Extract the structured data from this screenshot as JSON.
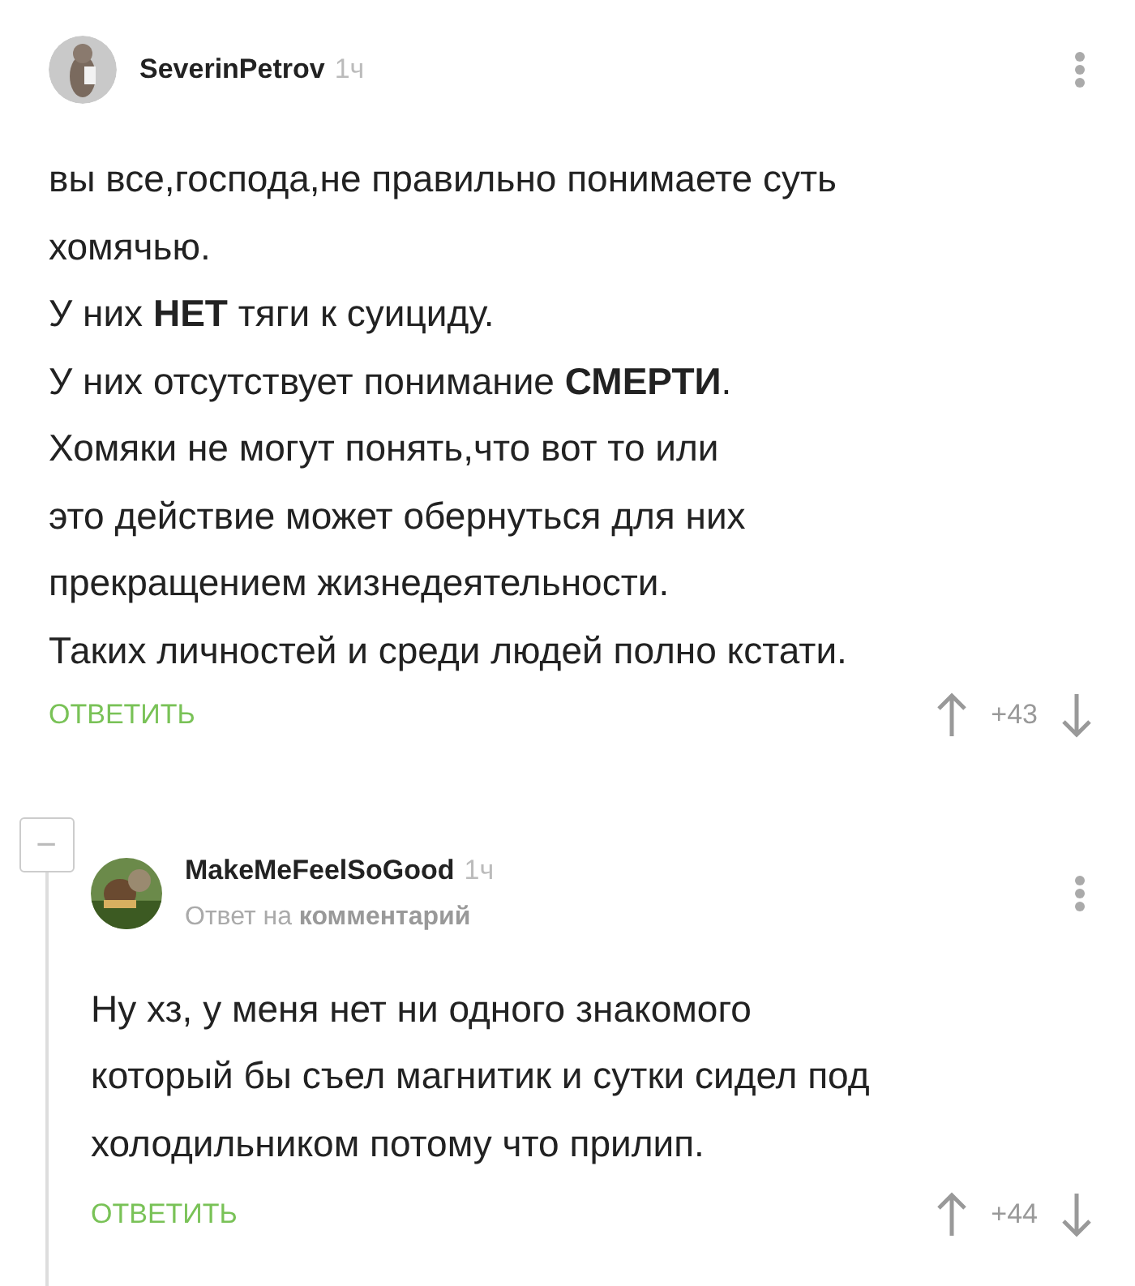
{
  "comments": [
    {
      "author": "SeverinPetrov",
      "time": "1ч",
      "lines": [
        "вы все,господа,не правильно понимаете суть",
        "хомячью.",
        "У них **НЕТ** тяги к суициду.",
        "У них отсутствует понимание **СМЕРТИ**.",
        "Хомяки не могут понять,что вот то или",
        "это действие может обернуться для них",
        "прекращением жизнедеятельности.",
        "Таких личностей и среди людей полно кстати."
      ],
      "reply": "ОТВЕТИТЬ",
      "score": "+43"
    },
    {
      "author": "MakeMeFeelSoGood",
      "time": "1ч",
      "reply_to": {
        "prefix": "Ответ на",
        "link": "комментарий"
      },
      "lines": [
        "Ну хз, у меня нет ни одного знакомого",
        "который бы съел магнитик и сутки сидел под",
        "холодильником потому что прилип."
      ],
      "reply": "ОТВЕТИТЬ",
      "score": "+44",
      "collapse": "−"
    }
  ]
}
